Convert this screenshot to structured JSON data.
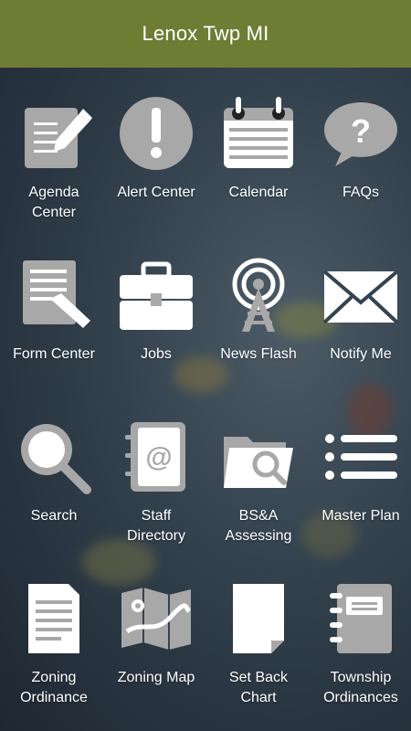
{
  "theme": {
    "header_bg": "#6f7d34",
    "icon_fill": "#a8a8a8",
    "icon_white": "#ffffff"
  },
  "header": {
    "title": "Lenox Twp MI"
  },
  "tiles": [
    {
      "label": "Agenda\nCenter",
      "icon": "agenda-edit-icon"
    },
    {
      "label": "Alert Center",
      "icon": "alert-exclamation-icon"
    },
    {
      "label": "Calendar",
      "icon": "calendar-icon"
    },
    {
      "label": "FAQs",
      "icon": "question-bubble-icon"
    },
    {
      "label": "Form Center",
      "icon": "form-pen-icon"
    },
    {
      "label": "Jobs",
      "icon": "briefcase-icon"
    },
    {
      "label": "News Flash",
      "icon": "broadcast-tower-icon"
    },
    {
      "label": "Notify Me",
      "icon": "envelope-icon"
    },
    {
      "label": "Search",
      "icon": "magnifier-icon"
    },
    {
      "label": "Staff\nDirectory",
      "icon": "address-book-icon"
    },
    {
      "label": "BS&A\nAssessing",
      "icon": "folder-search-icon"
    },
    {
      "label": "Master Plan",
      "icon": "list-icon"
    },
    {
      "label": "Zoning\nOrdinance",
      "icon": "document-icon"
    },
    {
      "label": "Zoning Map",
      "icon": "map-icon"
    },
    {
      "label": "Set Back\nChart",
      "icon": "page-icon"
    },
    {
      "label": "Township\nOrdinances",
      "icon": "notebook-icon"
    }
  ]
}
